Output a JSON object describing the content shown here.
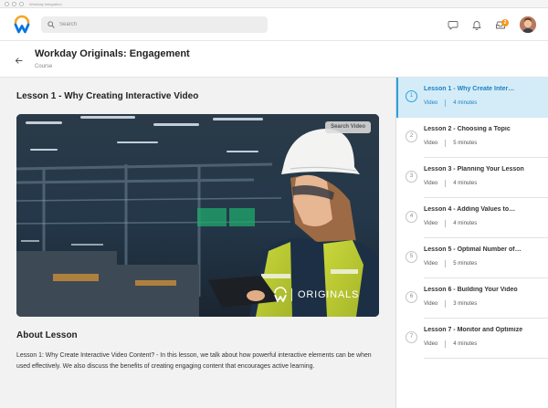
{
  "window": {
    "title": "Workday Integration"
  },
  "header": {
    "search_placeholder": "Search",
    "inbox_count": "2"
  },
  "course": {
    "title": "Workday Originals: Engagement",
    "subtitle": "Course"
  },
  "lesson": {
    "title": "Lesson 1 - Why Creating Interactive Video",
    "search_video_label": "Search Video",
    "originals_label": "ORIGINALS",
    "about_title": "About Lesson",
    "about_text": "Lesson 1: Why Create Interactive Video Content? - In this lesson, we talk about how powerful interactive elements can be when used effectively. We also discuss the benefits of creating engaging content that encourages active learning."
  },
  "sidebar": {
    "lessons": [
      {
        "number": "1",
        "title": "Lesson 1 - Why Create Inter…",
        "type": "Video",
        "duration": "4 minutes",
        "active": true
      },
      {
        "number": "2",
        "title": "Lesson 2 - Choosing a Topic",
        "type": "Video",
        "duration": "5 minutes",
        "active": false
      },
      {
        "number": "3",
        "title": "Lesson 3 - Planning Your Lesson",
        "type": "Video",
        "duration": "4 minutes",
        "active": false
      },
      {
        "number": "4",
        "title": "Lesson 4 - Adding Values to…",
        "type": "Video",
        "duration": "4 minutes",
        "active": false
      },
      {
        "number": "5",
        "title": "Lesson 5 - Optimal Number of…",
        "type": "Video",
        "duration": "5 minutes",
        "active": false
      },
      {
        "number": "6",
        "title": "Lesson 6 - Building Your Video",
        "type": "Video",
        "duration": "3 minutes",
        "active": false
      },
      {
        "number": "7",
        "title": "Lesson 7 - Monitor and Optimize",
        "type": "Video",
        "duration": "4 minutes",
        "active": false
      }
    ]
  },
  "colors": {
    "accent": "#2f9fdc",
    "active_bg": "#d4ecf8",
    "badge": "#f39a1c",
    "logo_blue": "#0875e1",
    "logo_orange": "#f5a623"
  },
  "icons": [
    "workday-logo",
    "search-icon",
    "chat-icon",
    "bell-icon",
    "inbox-icon",
    "back-arrow-icon"
  ]
}
